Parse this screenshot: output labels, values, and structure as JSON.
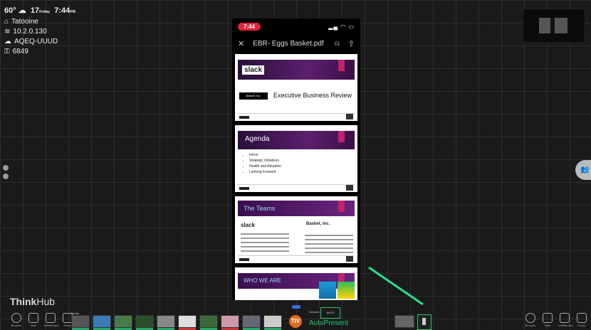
{
  "status": {
    "temp": "60°",
    "day": "17",
    "date_small": "Friday",
    "time": "7:44",
    "time_suffix": "PM",
    "room": "Tatooine",
    "ip": "10.2.0.130",
    "code": "AQEQ-UUUD",
    "pin": "6849"
  },
  "phone": {
    "time": "7:44",
    "title": "EBR- Eggs Basket.pdf",
    "slides": {
      "s1_logo": "slack",
      "s1_box": "Basket, Inc.",
      "s1_title": "Executive Business Review",
      "s2_title": "Agenda",
      "s2_items": [
        "Intros",
        "Strategic Initiatives",
        "Health and Adoption",
        "Looking Forward"
      ],
      "s3_title": "The Teams",
      "s3_slack": "slack",
      "s3_basket": "Basket, Inc.",
      "s4_title": "WHO WE ARE"
    }
  },
  "brand": {
    "think": "Think",
    "hub": "Hub"
  },
  "dock": {
    "left": [
      "Browser",
      "Note",
      "Whiteboard",
      "Group"
    ],
    "right": [
      "Browser",
      "Note",
      "Whiteboard",
      "Group"
    ],
    "media_label": "Media",
    "presenter_initials": "TIV",
    "devices_label": "Devices",
    "auto_label": "AUTO",
    "autopresent": "AutoPresent"
  },
  "colors": {
    "accent_green": "#28c76f",
    "slide_purple": "#5c1f6e",
    "pill_red": "#e0243a"
  }
}
